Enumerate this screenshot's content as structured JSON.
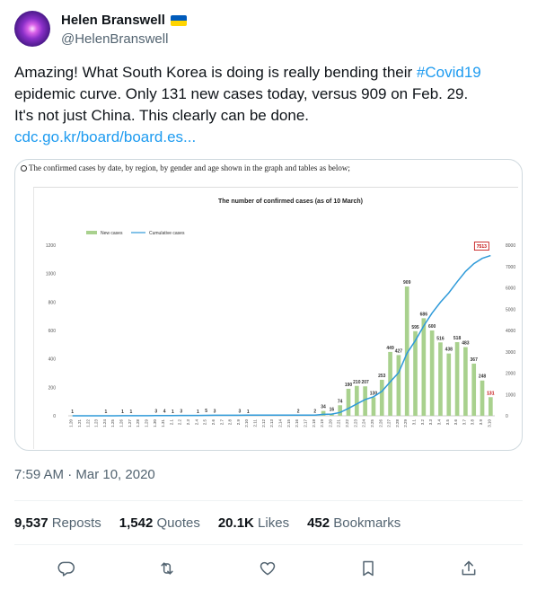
{
  "author": {
    "name": "Helen Branswell",
    "handle": "@HelenBranswell"
  },
  "tweet": {
    "line1_a": "Amazing! What South Korea is doing is really bending their ",
    "hashtag": "#Covid19",
    "line2": "epidemic curve. Only 131 new cases today, versus 909 on Feb. 29.",
    "line3": "It's not just China. This clearly can be done.",
    "link": "cdc.go.kr/board/board.es..."
  },
  "media": {
    "caption": "The confirmed cases by date, by region, by gender and age shown in the graph and tables as below;"
  },
  "timestamp": "7:59 AM · Mar 10, 2020",
  "stats": {
    "reposts_count": "9,537",
    "reposts_label": "Reposts",
    "quotes_count": "1,542",
    "quotes_label": "Quotes",
    "likes_count": "20.1K",
    "likes_label": "Likes",
    "bookmarks_count": "452",
    "bookmarks_label": "Bookmarks"
  },
  "actions": {
    "reply_icon": "reply-icon",
    "repost_icon": "repost-icon",
    "like_icon": "heart-icon",
    "bookmark_icon": "bookmark-icon",
    "share_icon": "share-icon"
  },
  "colors": {
    "link": "#1d9bf0",
    "bar": "#a9d18e",
    "line": "#2e9ad9",
    "highlight": "#c00000"
  },
  "chart_data": {
    "type": "bar",
    "title": "The number of confirmed cases (as of 10 March)",
    "legend": [
      "New cases",
      "Cumulative cases"
    ],
    "legend_position": "top-left",
    "categories": [
      "1.20",
      "1.21",
      "1.22",
      "1.23",
      "1.24",
      "1.25",
      "1.26",
      "1.27",
      "1.28",
      "1.29",
      "1.30",
      "1.31",
      "2.1",
      "2.2",
      "2.3",
      "2.4",
      "2.5",
      "2.6",
      "2.7",
      "2.8",
      "2.9",
      "2.10",
      "2.11",
      "2.12",
      "2.13",
      "2.14",
      "2.15",
      "2.16",
      "2.17",
      "2.18",
      "2.19",
      "2.20",
      "2.21",
      "2.22",
      "2.23",
      "2.24",
      "2.25",
      "2.26",
      "2.27",
      "2.28",
      "2.29",
      "3.1",
      "3.2",
      "3.3",
      "3.4",
      "3.5",
      "3.6",
      "3.7",
      "3.8",
      "3.9",
      "3.10"
    ],
    "series": [
      {
        "name": "New cases",
        "axis": "left",
        "values": [
          1,
          0,
          0,
          0,
          1,
          0,
          1,
          1,
          0,
          0,
          3,
          4,
          1,
          3,
          0,
          1,
          5,
          3,
          0,
          0,
          3,
          1,
          0,
          0,
          0,
          0,
          0,
          2,
          0,
          2,
          34,
          16,
          74,
          190,
          210,
          207,
          130,
          253,
          449,
          427,
          909,
          595,
          686,
          600,
          516,
          438,
          518,
          483,
          367,
          248,
          131
        ],
        "labels": [
          "1",
          "",
          "",
          "",
          "1",
          "",
          "1",
          "1",
          "",
          "",
          "3",
          "4",
          "1",
          "3",
          "",
          "1",
          "5",
          "3",
          "",
          "",
          "3",
          "1",
          "",
          "",
          "",
          "",
          "",
          "2",
          "",
          "2",
          "34",
          "16",
          "74",
          "190",
          "210",
          "207",
          "130",
          "253",
          "449",
          "427",
          "909",
          "595",
          "686",
          "600",
          "516",
          "438",
          "518",
          "483",
          "367",
          "248",
          "131"
        ]
      },
      {
        "name": "Cumulative cases",
        "axis": "right",
        "values": [
          1,
          1,
          1,
          1,
          2,
          2,
          3,
          4,
          4,
          4,
          7,
          11,
          12,
          15,
          15,
          16,
          21,
          24,
          24,
          24,
          27,
          28,
          28,
          28,
          28,
          28,
          28,
          30,
          30,
          32,
          66,
          82,
          156,
          346,
          556,
          763,
          893,
          1146,
          1595,
          2022,
          2931,
          3526,
          4212,
          4812,
          5328,
          5766,
          6284,
          6767,
          7134,
          7382,
          7513
        ],
        "end_label": "7513"
      }
    ],
    "ylim_left": [
      0,
      1200
    ],
    "yticks_left": [
      0,
      200,
      400,
      600,
      800,
      1000,
      1200
    ],
    "ylim_right": [
      0,
      8000
    ],
    "yticks_right": [
      0,
      1000,
      2000,
      3000,
      4000,
      5000,
      6000,
      7000,
      8000
    ],
    "grid": false
  }
}
